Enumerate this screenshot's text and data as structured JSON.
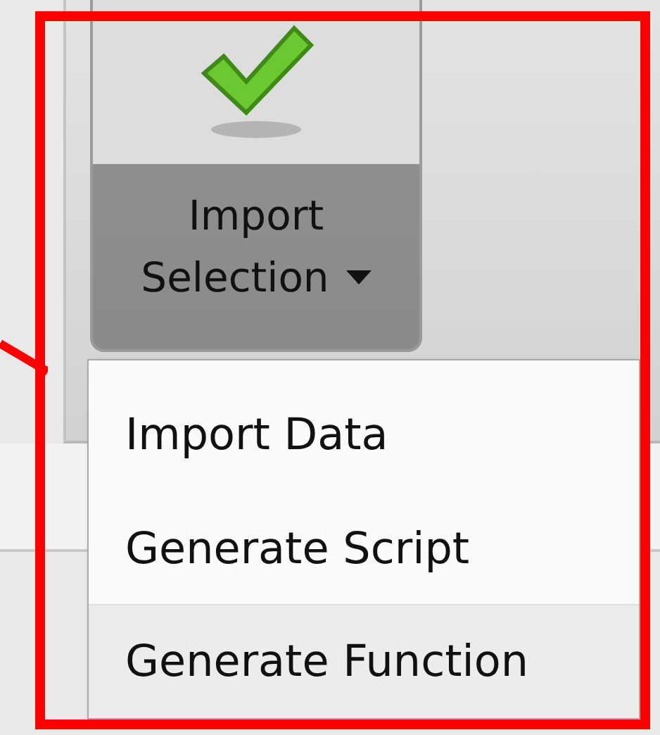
{
  "button": {
    "label_lines": [
      "Import",
      "Selection"
    ]
  },
  "menu": {
    "items": [
      {
        "label": "Import Data",
        "selected": false
      },
      {
        "label": "Generate Script",
        "selected": false
      },
      {
        "label": "Generate Function",
        "selected": true
      }
    ]
  }
}
